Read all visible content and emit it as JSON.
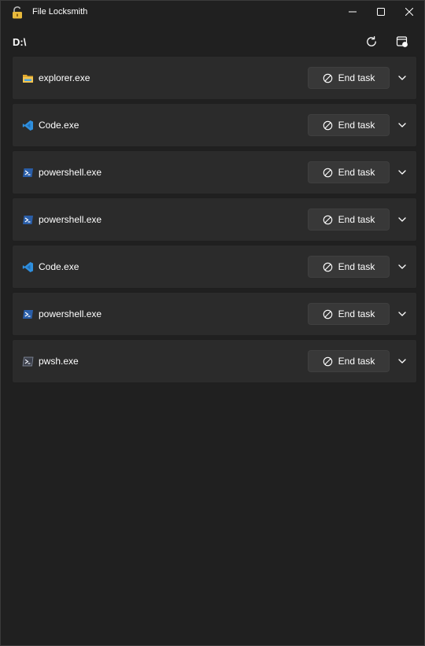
{
  "window": {
    "title": "File Locksmith"
  },
  "path": {
    "text": "D:\\"
  },
  "toolbar": {
    "refresh_icon": "refresh-icon",
    "admin_icon": "restart-as-admin-icon"
  },
  "processes": [
    {
      "name": "explorer.exe",
      "icon": "explorer-icon",
      "action": "End task"
    },
    {
      "name": "Code.exe",
      "icon": "vscode-icon",
      "action": "End task"
    },
    {
      "name": "powershell.exe",
      "icon": "powershell-icon",
      "action": "End task"
    },
    {
      "name": "powershell.exe",
      "icon": "powershell-icon",
      "action": "End task"
    },
    {
      "name": "Code.exe",
      "icon": "vscode-icon",
      "action": "End task"
    },
    {
      "name": "powershell.exe",
      "icon": "powershell-icon",
      "action": "End task"
    },
    {
      "name": "pwsh.exe",
      "icon": "pwsh-icon",
      "action": "End task"
    }
  ],
  "colors": {
    "background": "#202020",
    "card": "#2b2b2b",
    "button": "#383838",
    "vscode_blue": "#2f8fde",
    "powershell_blue": "#2a5ea8",
    "explorer_yellow": "#f4c44e"
  }
}
